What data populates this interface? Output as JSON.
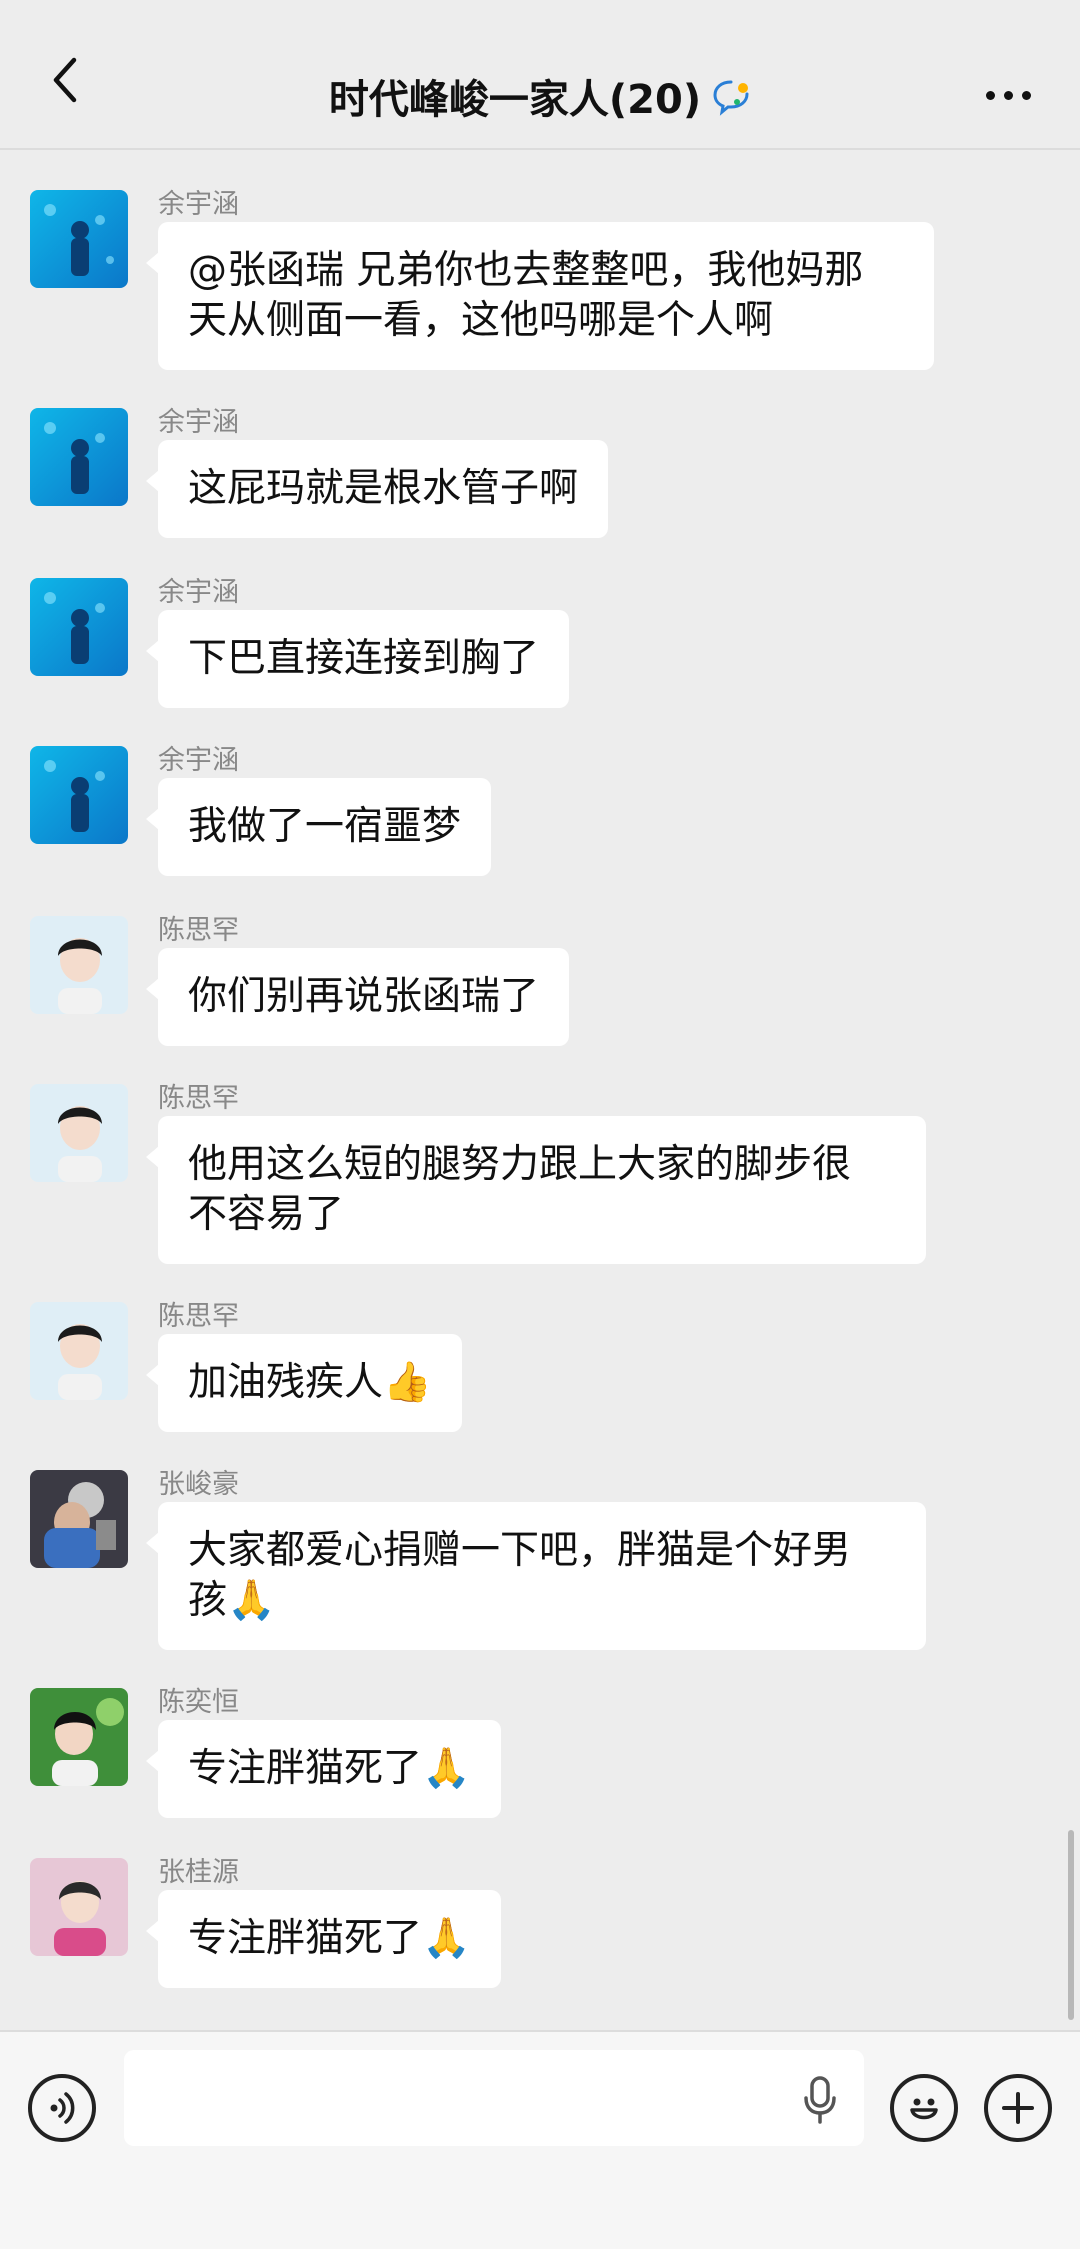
{
  "header": {
    "title": "时代峰峻一家人(20)",
    "back_icon": "chevron-left-icon",
    "more_icon": "more-dots-icon"
  },
  "messages": [
    {
      "sender": "余宇涵",
      "avatar": "blue-aquarium-avatar",
      "text": "@张函瑞 兄弟你也去整整吧，我他妈那\n天从侧面一看，这他吗哪是个人啊"
    },
    {
      "sender": "余宇涵",
      "avatar": "blue-aquarium-avatar",
      "text": "这屁玛就是根水管子啊"
    },
    {
      "sender": "余宇涵",
      "avatar": "blue-aquarium-avatar",
      "text": "下巴直接连接到胸了"
    },
    {
      "sender": "余宇涵",
      "avatar": "blue-aquarium-avatar",
      "text": "我做了一宿噩梦"
    },
    {
      "sender": "陈思罕",
      "avatar": "portrait-avatar",
      "text": "你们别再说张函瑞了"
    },
    {
      "sender": "陈思罕",
      "avatar": "portrait-avatar",
      "text": "他用这么短的腿努力跟上大家的脚步很\n不容易了"
    },
    {
      "sender": "陈思罕",
      "avatar": "portrait-avatar",
      "text": "加油残疾人👍"
    },
    {
      "sender": "张峻豪",
      "avatar": "photo-avatar",
      "text": "大家都爱心捐赠一下吧，胖猫是个好男\n孩🙏"
    },
    {
      "sender": "陈奕恒",
      "avatar": "green-portrait-avatar",
      "text": "专注胖猫死了🙏"
    },
    {
      "sender": "张桂源",
      "avatar": "pink-portrait-avatar",
      "text": "专注胖猫死了🙏"
    }
  ],
  "input_bar": {
    "voice_icon": "voice-icon",
    "mic_icon": "mic-icon",
    "emoji_icon": "emoji-icon",
    "plus_icon": "plus-icon"
  }
}
